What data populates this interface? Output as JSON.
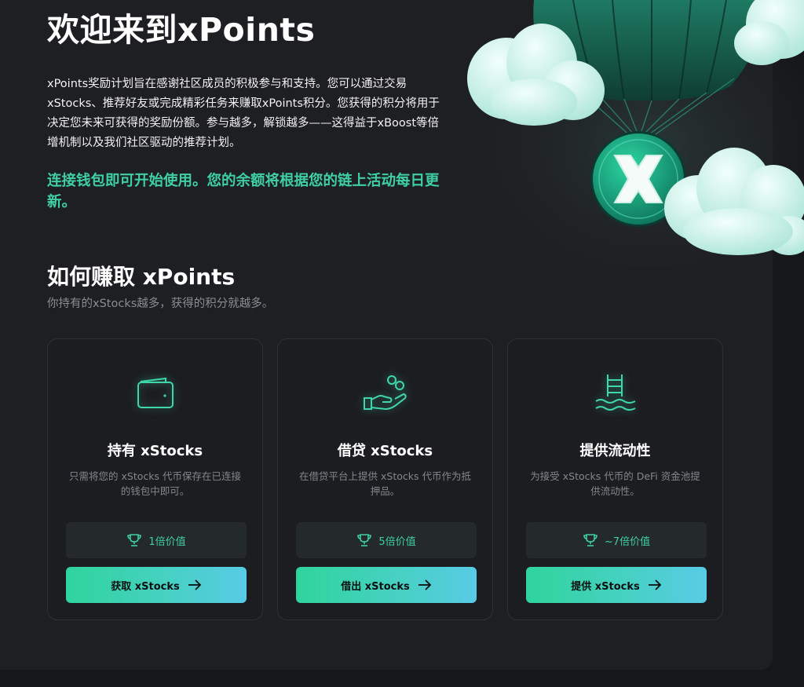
{
  "hero": {
    "title": "欢迎来到xPoints",
    "intro": "xPoints奖励计划旨在感谢社区成员的积极参与和支持。您可以通过交易xStocks、推荐好友或完成精彩任务来赚取xPoints积分。您获得的积分将用于决定您未来可获得的奖励份额。参与越多，解锁越多——这得益于xBoost等倍增机制以及我们社区驱动的推荐计划。",
    "connect_note": "连接钱包即可开始使用。您的余额将根据您的链上活动每日更新。",
    "art_icon": "parachute-x-logo-icon"
  },
  "how": {
    "title": "如何赚取 xPoints",
    "subtitle": "你持有的xStocks越多，获得的积分就越多。"
  },
  "cards": [
    {
      "icon": "wallet-icon",
      "title": "持有 xStocks",
      "description": "只需将您的 xStocks 代币保存在已连接的钱包中即可。",
      "multiplier": "1倍价值",
      "button": "获取 xStocks"
    },
    {
      "icon": "hand-coins-icon",
      "title": "借贷 xStocks",
      "description": "在借贷平台上提供 xStocks 代币作为抵押品。",
      "multiplier": "5倍价值",
      "button": "借出 xStocks"
    },
    {
      "icon": "pool-ladder-icon",
      "title": "提供流动性",
      "description": "为接受 xStocks 代币的 DeFi 资金池提供流动性。",
      "multiplier": "~7倍价值",
      "button": "提供 xStocks"
    }
  ],
  "colors": {
    "accent": "#3ecfa5",
    "background": "#161719",
    "panel": "#1e1f22",
    "button_gradient_start": "#2fd49b",
    "button_gradient_end": "#58cbe6"
  }
}
